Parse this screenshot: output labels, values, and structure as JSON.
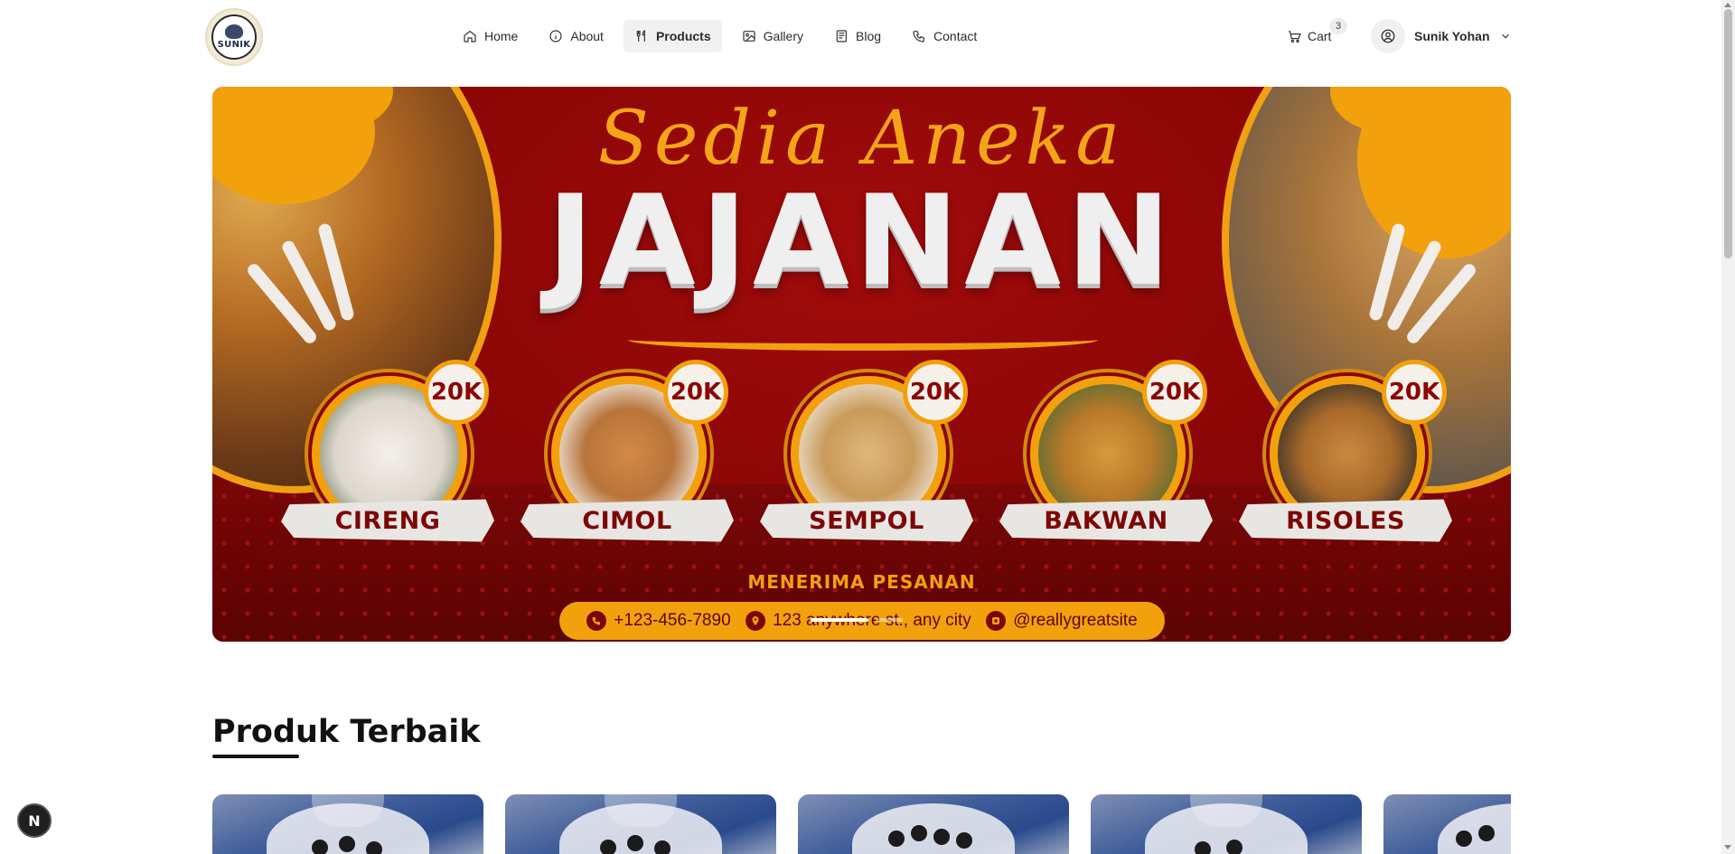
{
  "header": {
    "logo_text": "SUNIK",
    "nav": [
      {
        "label": "Home",
        "icon": "home-icon",
        "active": false
      },
      {
        "label": "About",
        "icon": "info-icon",
        "active": false
      },
      {
        "label": "Products",
        "icon": "utensils-icon",
        "active": true
      },
      {
        "label": "Gallery",
        "icon": "image-icon",
        "active": false
      },
      {
        "label": "Blog",
        "icon": "newspaper-icon",
        "active": false
      },
      {
        "label": "Contact",
        "icon": "phone-icon",
        "active": false
      }
    ],
    "cart": {
      "label": "Cart",
      "count": "3"
    },
    "user": {
      "name": "Sunik Yohan"
    }
  },
  "hero": {
    "script_title": "Sedia Aneka",
    "main_title": "JAJANAN",
    "foods": [
      {
        "name": "CIRENG",
        "price": "20K"
      },
      {
        "name": "CIMOL",
        "price": "20K"
      },
      {
        "name": "SEMPOL",
        "price": "20K"
      },
      {
        "name": "BAKWAN",
        "price": "20K"
      },
      {
        "name": "RISOLES",
        "price": "20K"
      }
    ],
    "order_title": "MENERIMA PESANAN",
    "contacts": {
      "phone": "+123-456-7890",
      "address": "123 anywhere st., any city",
      "instagram": "@reallygreatsite"
    },
    "slides": {
      "count": 2,
      "active_index": 0
    },
    "colors": {
      "maroon": "#8a0606",
      "gold": "#f3a00d"
    }
  },
  "section": {
    "title": "Produk Terbaik"
  },
  "floating_badge": "N"
}
